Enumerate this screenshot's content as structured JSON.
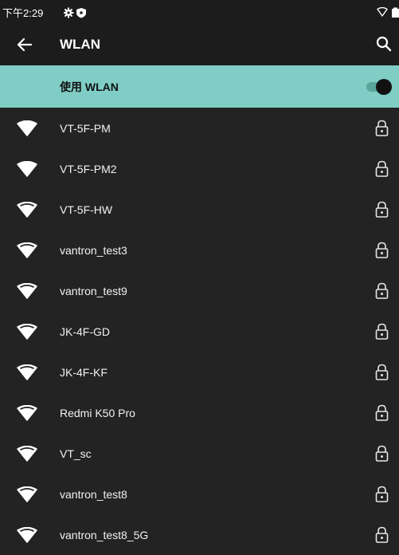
{
  "status": {
    "time": "下午2:29"
  },
  "header": {
    "title": "WLAN"
  },
  "master_switch": {
    "label": "使用 WLAN",
    "on": true
  },
  "networks": [
    {
      "ssid": "VT-5F-PM",
      "secured": true,
      "signal": "full"
    },
    {
      "ssid": "VT-5F-PM2",
      "secured": true,
      "signal": "full"
    },
    {
      "ssid": "VT-5F-HW",
      "secured": true,
      "signal": "high"
    },
    {
      "ssid": "vantron_test3",
      "secured": true,
      "signal": "high"
    },
    {
      "ssid": "vantron_test9",
      "secured": true,
      "signal": "high"
    },
    {
      "ssid": "JK-4F-GD",
      "secured": true,
      "signal": "high"
    },
    {
      "ssid": "JK-4F-KF",
      "secured": true,
      "signal": "high"
    },
    {
      "ssid": "Redmi K50 Pro",
      "secured": true,
      "signal": "high"
    },
    {
      "ssid": "VT_sc",
      "secured": true,
      "signal": "high"
    },
    {
      "ssid": "vantron_test8",
      "secured": true,
      "signal": "high"
    },
    {
      "ssid": "vantron_test8_5G",
      "secured": true,
      "signal": "high"
    }
  ],
  "colors": {
    "background": "#232323",
    "bar": "#1c1c1c",
    "highlight": "#7fcdc5",
    "text": "#f2f2f2"
  }
}
